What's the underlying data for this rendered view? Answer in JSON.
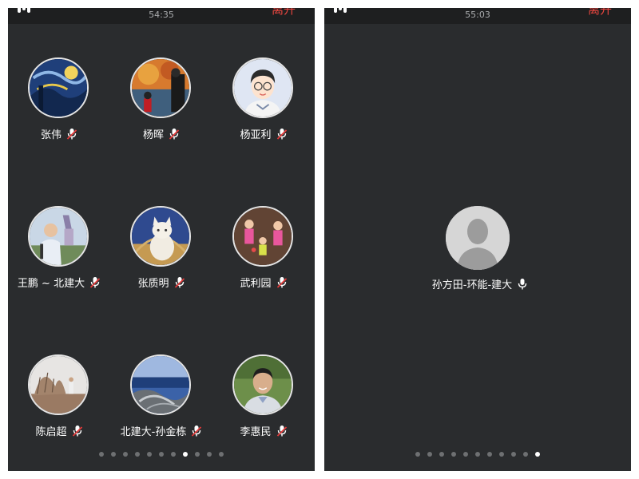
{
  "left_panel": {
    "timer": "54:35",
    "leave_label": "离开",
    "participants": [
      {
        "name": "张伟",
        "mic": "muted"
      },
      {
        "name": "杨晖",
        "mic": "muted"
      },
      {
        "name": "杨亚利",
        "mic": "muted"
      },
      {
        "name": "王鹏 ~ 北建大",
        "mic": "muted"
      },
      {
        "name": "张质明",
        "mic": "muted"
      },
      {
        "name": "武利园",
        "mic": "muted"
      },
      {
        "name": "陈启超",
        "mic": "muted"
      },
      {
        "name": "北建大-孙金栋",
        "mic": "muted"
      },
      {
        "name": "李惠民",
        "mic": "muted"
      }
    ],
    "page_dots": 11,
    "active_dot_index": 7
  },
  "right_panel": {
    "timer": "55:03",
    "leave_label": "离开",
    "participant": {
      "name": "孙方田-环能-建大",
      "mic": "on"
    },
    "page_dots": 11,
    "active_dot_index": 10
  },
  "colors": {
    "panel_bg": "#2a2c2e",
    "topbar_bg": "#1e1f20",
    "leave_red": "#e9463f",
    "mic_muted_red": "#e33a3a"
  }
}
